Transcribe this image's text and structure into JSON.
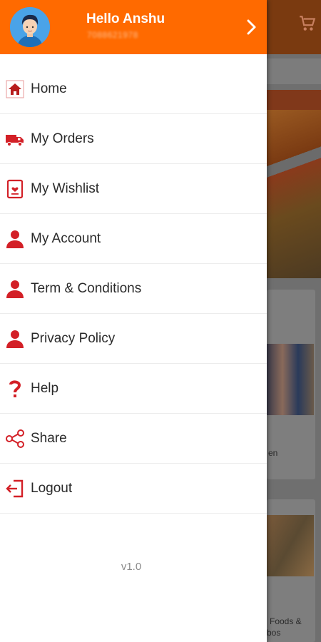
{
  "header": {
    "greeting": "Hello Anshu",
    "phone": "7088621978"
  },
  "menu": {
    "items": [
      {
        "label": "Home",
        "icon": "home-icon"
      },
      {
        "label": "My Orders",
        "icon": "truck-icon"
      },
      {
        "label": "My Wishlist",
        "icon": "wishlist-icon"
      },
      {
        "label": "My Account",
        "icon": "user-icon"
      },
      {
        "label": "Term & Conditions",
        "icon": "user-icon"
      },
      {
        "label": "Privacy Policy",
        "icon": "user-icon"
      },
      {
        "label": "Help",
        "icon": "question-icon"
      },
      {
        "label": "Share",
        "icon": "share-icon"
      },
      {
        "label": "Logout",
        "icon": "logout-icon"
      }
    ]
  },
  "version": "v1.0",
  "background": {
    "card1_text": "en",
    "card2_text_line1": "Foods &",
    "card2_text_line2": "bos"
  },
  "colors": {
    "header": "#ff6a00",
    "icon": "#d32027",
    "text": "#2a2a2a"
  }
}
